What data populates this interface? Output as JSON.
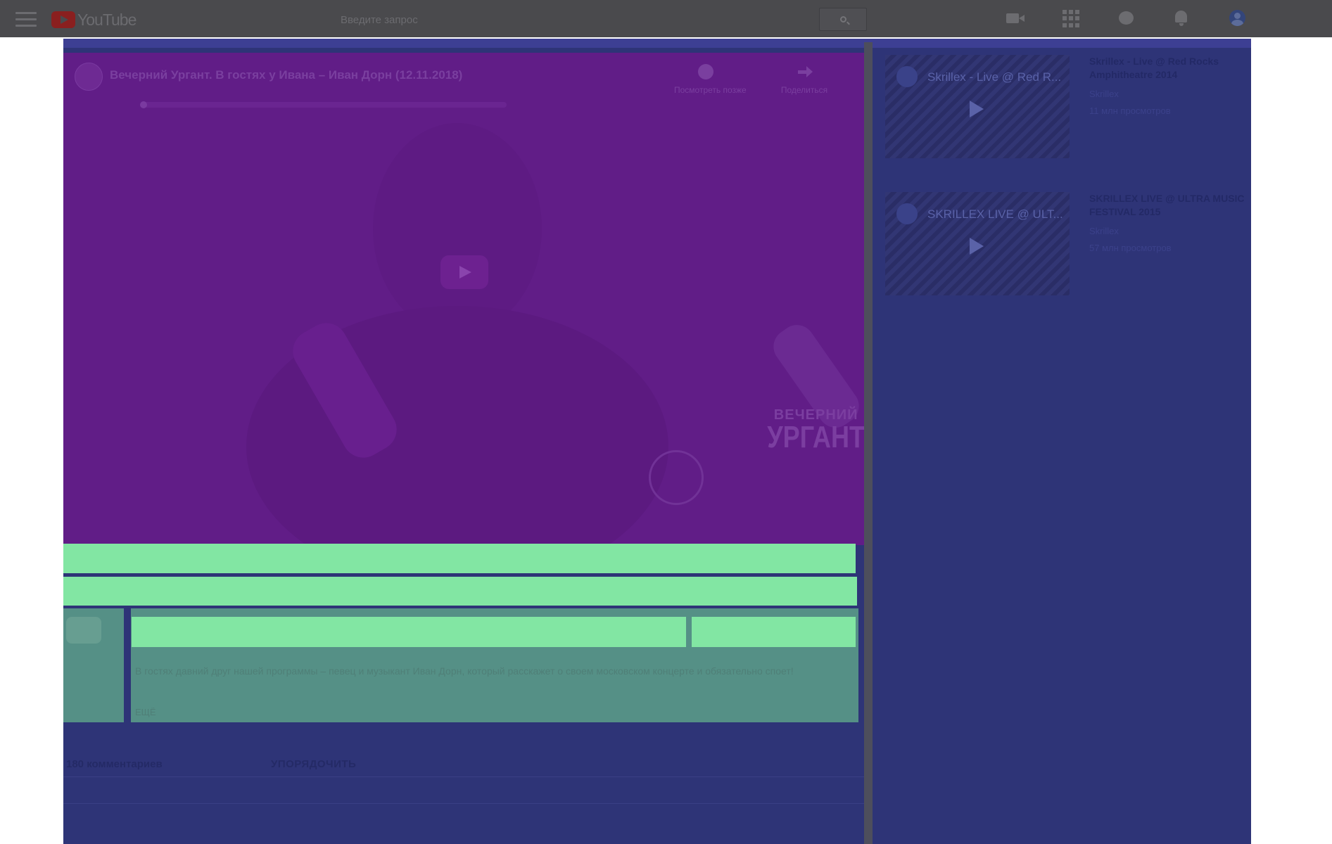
{
  "header": {
    "logo_text": "YouTube",
    "search_placeholder": "Введите запрос"
  },
  "player": {
    "title": "Вечерний Ургант. В гостях у Ивана – Иван Дорн (12.11.2018)",
    "actions": [
      {
        "label": "Посмотреть позже"
      },
      {
        "label": "Поделиться"
      }
    ],
    "brand_small": "ВЕЧЕРНИЙ",
    "brand_big": "УРГАНТ"
  },
  "owner": {
    "avatar_label": "",
    "description": "В гостях давний друг нашей программы – певец и музыкант Иван Дорн, который расскажет о своем московском концерте и обязательно споет!",
    "more": "ЕЩЁ"
  },
  "comments": {
    "count_label": "180 комментариев",
    "sort_label": "УПОРЯДОЧИТЬ"
  },
  "related": [
    {
      "thumb_title": "Skrillex - Live @ Red R...",
      "title": "Skrillex - Live @ Red Rocks Amphitheatre 2014",
      "channel": "Skrillex",
      "views": "11 млн просмотров"
    },
    {
      "thumb_title": "SKRILLEX LIVE @ ULT...",
      "title": "SKRILLEX LIVE @ ULTRA MUSIC FESTIVAL 2015",
      "channel": "Skrillex",
      "views": "57 млн просмотров"
    }
  ],
  "colors": {
    "topbar": "#4a4a4d",
    "overlay": "#2e3477",
    "player": "#611d87",
    "highlight": "#82e6a3",
    "owner": "#559086"
  }
}
